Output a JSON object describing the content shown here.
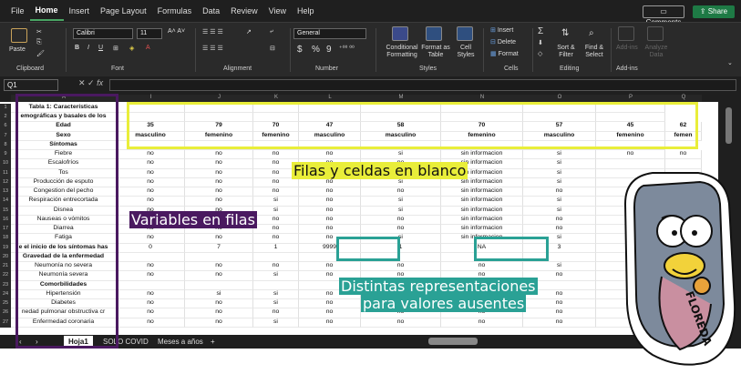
{
  "menu": {
    "tabs": [
      "File",
      "Home",
      "Insert",
      "Page Layout",
      "Formulas",
      "Data",
      "Review",
      "View",
      "Help"
    ],
    "active": "Home",
    "comments": "Comments",
    "share": "Share"
  },
  "ribbon": {
    "clipboard": {
      "paste": "Paste",
      "label": "Clipboard"
    },
    "font": {
      "name": "Calibri",
      "size": "11",
      "label": "Font"
    },
    "alignment": {
      "label": "Alignment"
    },
    "number": {
      "format": "General",
      "label": "Number",
      "currency": "$",
      "percent": "%"
    },
    "styles": {
      "conditional": "Conditional Formatting",
      "format_table": "Format as Table",
      "cell_styles": "Cell Styles",
      "label": "Styles"
    },
    "cells": {
      "insert": "Insert",
      "delete": "Delete",
      "format": "Format",
      "label": "Cells"
    },
    "editing": {
      "sum": "Σ",
      "sort": "Sort & Filter",
      "find": "Find & Select",
      "label": "Editing"
    },
    "addins": {
      "addins": "Add-ins",
      "analyze": "Analyze Data",
      "label": "Add-ins"
    }
  },
  "formula_bar": {
    "name_box": "Q1",
    "fx": "fx"
  },
  "columns": [
    "A",
    "I",
    "J",
    "K",
    "L",
    "M",
    "N",
    "O",
    "P",
    "Q"
  ],
  "rows": [
    {
      "n": "1",
      "cells": [
        "Tabla 1: Características",
        "",
        "",
        "",
        "",
        "",
        "",
        "",
        ""
      ],
      "bold": true
    },
    {
      "n": "2",
      "cells": [
        "emográficas y basales de los",
        "",
        "",
        "",
        "",
        "",
        "",
        "",
        ""
      ],
      "bold": true
    },
    {
      "n": "6",
      "cells": [
        "Edad",
        "35",
        "79",
        "70",
        "47",
        "58",
        "70",
        "57",
        "45",
        "62"
      ],
      "bold": true
    },
    {
      "n": "7",
      "cells": [
        "Sexo",
        "masculino",
        "femenino",
        "femenino",
        "masculino",
        "masculino",
        "femenino",
        "masculino",
        "femenino",
        "femen"
      ],
      "bold": true
    },
    {
      "n": "8",
      "cells": [
        "Síntomas",
        "",
        "",
        "",
        "",
        "",
        "",
        "",
        ""
      ],
      "bold": true
    },
    {
      "n": "9",
      "cells": [
        "Fiebre",
        "no",
        "no",
        "no",
        "no",
        "si",
        "sin informacion",
        "si",
        "no",
        "no"
      ]
    },
    {
      "n": "10",
      "cells": [
        "Escalofríos",
        "no",
        "no",
        "no",
        "no",
        "no",
        "sin informacion",
        "si",
        "",
        ""
      ]
    },
    {
      "n": "11",
      "cells": [
        "Tos",
        "no",
        "no",
        "no",
        "no",
        "si",
        "sin informacion",
        "si",
        "",
        ""
      ]
    },
    {
      "n": "12",
      "cells": [
        "Producción de esputo",
        "no",
        "no",
        "no",
        "no",
        "si",
        "sin informacion",
        "si",
        "",
        ""
      ]
    },
    {
      "n": "13",
      "cells": [
        "Congestion del pecho",
        "no",
        "no",
        "no",
        "no",
        "no",
        "sin informacion",
        "no",
        "",
        ""
      ]
    },
    {
      "n": "14",
      "cells": [
        "Respiración entrecortada",
        "no",
        "no",
        "si",
        "no",
        "si",
        "sin informacion",
        "si",
        "",
        ""
      ]
    },
    {
      "n": "15",
      "cells": [
        "Disnea",
        "no",
        "no",
        "si",
        "no",
        "si",
        "sin informacion",
        "si",
        "",
        ""
      ]
    },
    {
      "n": "16",
      "cells": [
        "Nauseas o vómitos",
        "no",
        "no",
        "no",
        "no",
        "no",
        "sin informacion",
        "no",
        "",
        ""
      ]
    },
    {
      "n": "17",
      "cells": [
        "Diarrea",
        "no",
        "no",
        "no",
        "no",
        "no",
        "sin informacion",
        "no",
        "",
        ""
      ]
    },
    {
      "n": "18",
      "cells": [
        "Fatiga",
        "no",
        "no",
        "no",
        "no",
        "si",
        "sin informacion",
        "si",
        "",
        ""
      ]
    },
    {
      "n": "19",
      "cells": [
        "e el inicio de los síntomas has",
        "0",
        "7",
        "1",
        "9999",
        "1",
        "NA",
        "3",
        "",
        ""
      ],
      "bold_first": true
    },
    {
      "n": "20",
      "cells": [
        "Gravedad de la enfermedad",
        "",
        "",
        "",
        "",
        "",
        "",
        "",
        ""
      ],
      "bold": true
    },
    {
      "n": "21",
      "cells": [
        "Neumonía no severa",
        "no",
        "no",
        "no",
        "no",
        "no",
        "no",
        "si",
        "",
        ""
      ]
    },
    {
      "n": "22",
      "cells": [
        "Neumonía severa",
        "no",
        "no",
        "si",
        "no",
        "no",
        "no",
        "no",
        "",
        ""
      ]
    },
    {
      "n": "23",
      "cells": [
        "Comorbilidades",
        "",
        "",
        "",
        "",
        "",
        "",
        "",
        ""
      ],
      "bold": true
    },
    {
      "n": "24",
      "cells": [
        "Hipertensión",
        "no",
        "si",
        "si",
        "no",
        "",
        "",
        "no",
        "",
        ""
      ]
    },
    {
      "n": "25",
      "cells": [
        "Diabetes",
        "no",
        "no",
        "si",
        "no",
        "",
        "",
        "no",
        "",
        ""
      ]
    },
    {
      "n": "26",
      "cells": [
        "nedad pulmonar obstructiva cr",
        "no",
        "no",
        "no",
        "no",
        "no",
        "no",
        "no",
        "",
        ""
      ]
    },
    {
      "n": "27",
      "cells": [
        "Enfermedad coronaria",
        "no",
        "no",
        "si",
        "no",
        "no",
        "no",
        "no",
        "",
        ""
      ]
    }
  ],
  "sheet_tabs": [
    "Hoja1",
    "SOLO COVID",
    "Meses a años"
  ],
  "active_sheet": "Hoja1",
  "annotations": {
    "blank": "Filas y celdas en blanco",
    "variables": "Variables en filas",
    "missing_1": "Distintas representaciones",
    "missing_2": "para valores ausentes",
    "sticker_letters": "FLOREDA"
  },
  "colors": {
    "yellow": "#e9ee3a",
    "purple": "#4a1960",
    "teal": "#2aa195",
    "excel_green": "#1e7a45"
  }
}
